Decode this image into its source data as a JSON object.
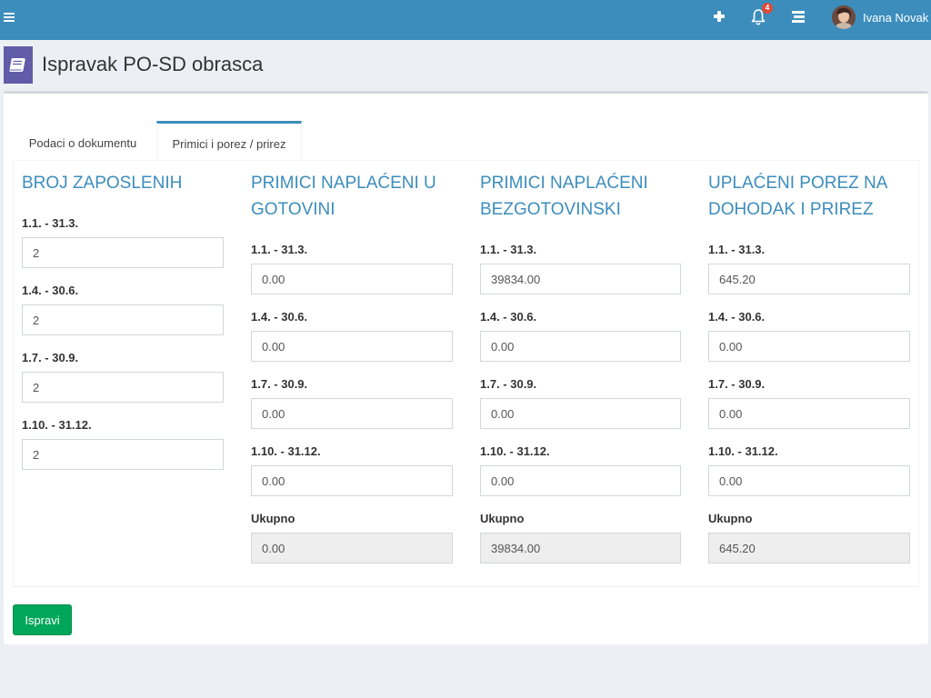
{
  "topbar": {
    "notification_count": "4",
    "user_name": "Ivana Novak",
    "brand_color": "#3c8dbc"
  },
  "page": {
    "title": "Ispravak PO-SD obrasca"
  },
  "tabs": [
    {
      "label": "Podaci o dokumentu",
      "active": false
    },
    {
      "label": "Primici i porez / prirez",
      "active": true
    }
  ],
  "columns": [
    {
      "heading": "BROJ ZAPOSLENIH",
      "fields": [
        {
          "label": "1.1. - 31.3.",
          "value": "2"
        },
        {
          "label": "1.4. - 30.6.",
          "value": "2"
        },
        {
          "label": "1.7. - 30.9.",
          "value": "2"
        },
        {
          "label": "1.10. - 31.12.",
          "value": "2"
        }
      ]
    },
    {
      "heading": "PRIMICI NAPLAĆENI U GOTOVINI",
      "fields": [
        {
          "label": "1.1. - 31.3.",
          "value": "0.00"
        },
        {
          "label": "1.4. - 30.6.",
          "value": "0.00"
        },
        {
          "label": "1.7. - 30.9.",
          "value": "0.00"
        },
        {
          "label": "1.10. - 31.12.",
          "value": "0.00"
        }
      ],
      "total": {
        "label": "Ukupno",
        "value": "0.00"
      }
    },
    {
      "heading": "PRIMICI NAPLAĆENI BEZGOTOVINSKI",
      "fields": [
        {
          "label": "1.1. - 31.3.",
          "value": "39834.00"
        },
        {
          "label": "1.4. - 30.6.",
          "value": "0.00"
        },
        {
          "label": "1.7. - 30.9.",
          "value": "0.00"
        },
        {
          "label": "1.10. - 31.12.",
          "value": "0.00"
        }
      ],
      "total": {
        "label": "Ukupno",
        "value": "39834.00"
      }
    },
    {
      "heading": "UPLAĆENI POREZ NA DOHODAK I PRIREZ",
      "fields": [
        {
          "label": "1.1. - 31.3.",
          "value": "645.20"
        },
        {
          "label": "1.4. - 30.6.",
          "value": "0.00"
        },
        {
          "label": "1.7. - 30.9.",
          "value": "0.00"
        },
        {
          "label": "1.10. - 31.12.",
          "value": "0.00"
        }
      ],
      "total": {
        "label": "Ukupno",
        "value": "645.20"
      }
    }
  ],
  "actions": {
    "submit_label": "Ispravi"
  }
}
